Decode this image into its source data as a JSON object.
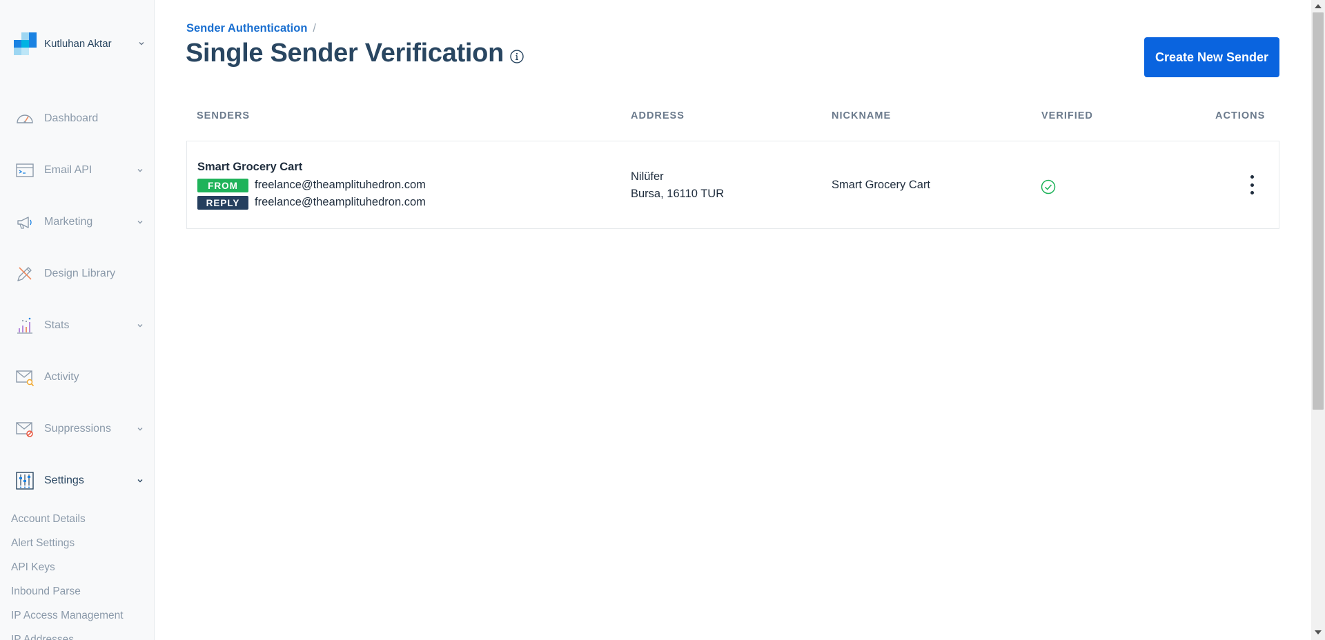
{
  "account": {
    "name": "Kutluhan Aktar"
  },
  "nav": [
    {
      "label": "Dashboard",
      "icon": "dashboard-gauge-icon",
      "has_chevron": false
    },
    {
      "label": "Email API",
      "icon": "code-window-icon",
      "has_chevron": true
    },
    {
      "label": "Marketing",
      "icon": "megaphone-icon",
      "has_chevron": true
    },
    {
      "label": "Design Library",
      "icon": "pencil-ruler-icon",
      "has_chevron": false
    },
    {
      "label": "Stats",
      "icon": "bar-chart-icon",
      "has_chevron": true
    },
    {
      "label": "Activity",
      "icon": "envelope-search-icon",
      "has_chevron": false
    },
    {
      "label": "Suppressions",
      "icon": "envelope-blocked-icon",
      "has_chevron": true
    },
    {
      "label": "Settings",
      "icon": "sliders-icon",
      "has_chevron": true,
      "active": true
    }
  ],
  "settings_subnav": [
    "Account Details",
    "Alert Settings",
    "API Keys",
    "Inbound Parse",
    "IP Access Management",
    "IP Addresses"
  ],
  "breadcrumb": {
    "parent": "Sender Authentication",
    "separator": "/"
  },
  "page": {
    "title": "Single Sender Verification"
  },
  "create_button": {
    "label": "Create New Sender"
  },
  "table": {
    "columns": [
      "SENDERS",
      "ADDRESS",
      "NICKNAME",
      "VERIFIED",
      "ACTIONS"
    ],
    "rows": [
      {
        "sender_name": "Smart Grocery Cart",
        "from_tag": "FROM",
        "from_email": "freelance@theamplituhedron.com",
        "reply_tag": "REPLY",
        "reply_email": "freelance@theamplituhedron.com",
        "address_line1": "Nilüfer",
        "address_line2": "Bursa, 16110 TUR",
        "nickname": "Smart Grocery Cart",
        "verified": true
      }
    ]
  },
  "colors": {
    "primary": "#0a64df",
    "from_tag": "#1fb35a",
    "reply_tag": "#253f5e",
    "verified": "#1fb35a",
    "title": "#294661"
  }
}
